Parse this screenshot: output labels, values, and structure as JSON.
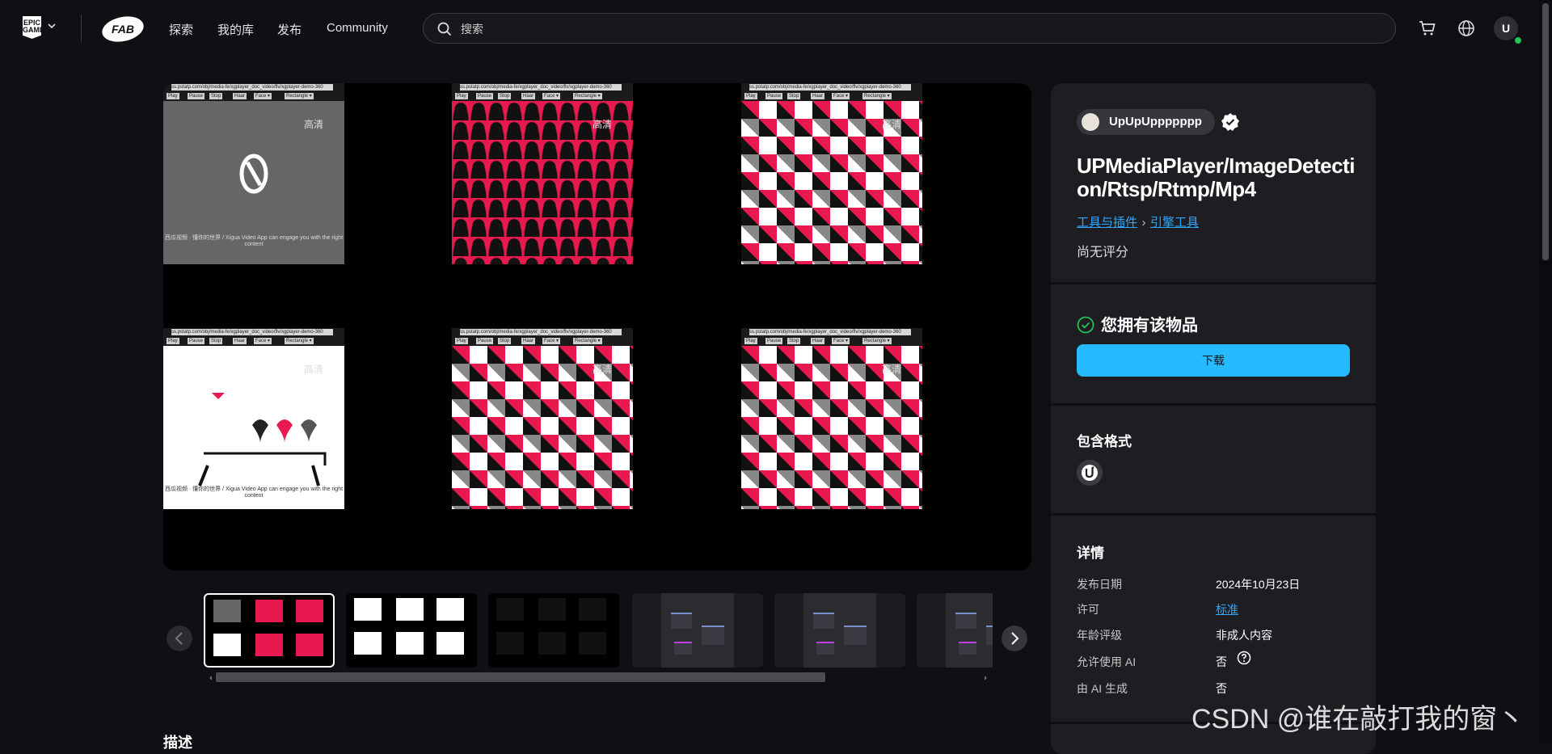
{
  "nav": {
    "epic_logo_text": "EPIC GAMES",
    "fab_logo_text": "FAB",
    "links": [
      "探索",
      "我的库",
      "发布",
      "Community"
    ],
    "search_placeholder": "搜索",
    "avatar_initial": "U",
    "icons": [
      "cart-icon",
      "globe-icon"
    ]
  },
  "gallery": {
    "tiles": [
      {
        "pattern": "gray",
        "url": "ss.pstatp.com/obj/media-fe/xgplayer_doc_video/flv/xgplayer-demo-360",
        "caption": "西瓜视频 · 懂你的世界 / Xigua Video App can engage you with the right content",
        "quality": "高清"
      },
      {
        "pattern": "red",
        "url": "ss.pstatp.com/obj/media-fe/xgplayer_doc_video/flv/xgplayer-demo-360",
        "caption": "",
        "quality": "高清"
      },
      {
        "pattern": "check",
        "url": "ss.pstatp.com/obj/media-fe/xgplayer_doc_video/flv/xgplayer-demo-360",
        "caption": "",
        "quality": "高清"
      },
      {
        "pattern": "white",
        "url": "ss.pstatp.com/obj/media-fe/xgplayer_doc_video/flv/xgplayer-demo-360",
        "caption": "西瓜视频 · 懂你的世界 / Xigua Video App can engage you with the right content",
        "quality": "高清"
      },
      {
        "pattern": "check",
        "url": "ss.pstatp.com/obj/media-fe/xgplayer_doc_video/flv/xgplayer-demo-360",
        "caption": "",
        "quality": "高清"
      },
      {
        "pattern": "check",
        "url": "ss.pstatp.com/obj/media-fe/xgplayer_doc_video/flv/xgplayer-demo-360",
        "caption": "",
        "quality": "高清"
      }
    ],
    "controls": [
      "Play",
      "Pause",
      "Stop",
      "Haar",
      "Face ▾",
      "Rectangle ▾"
    ]
  },
  "description_heading": "描述",
  "product": {
    "publisher": "UpUpUppppppp",
    "title": "UPMediaPlayer/ImageDetection/Rtsp/Rtmp/Mp4",
    "breadcrumb": [
      "工具与插件",
      "引擎工具"
    ],
    "rating": "尚无评分",
    "owned_text": "您拥有该物品",
    "download_label": "下载",
    "formats_heading": "包含格式",
    "format_icons": [
      "unreal-engine-icon"
    ],
    "details_heading": "详情",
    "details": [
      {
        "label": "发布日期",
        "value": "2024年10月23日"
      },
      {
        "label": "许可",
        "value": "标准"
      },
      {
        "label": "年龄评级",
        "value": "非成人内容"
      },
      {
        "label": "允许使用 AI",
        "value": "否"
      },
      {
        "label": "由 AI 生成",
        "value": "否"
      }
    ]
  },
  "watermark": "CSDN @谁在敲打我的窗丶",
  "colors": {
    "accent": "#26bbff",
    "link": "#2ea8ff",
    "background": "#101014",
    "panel": "#1d1d22",
    "success": "#25c25a"
  }
}
